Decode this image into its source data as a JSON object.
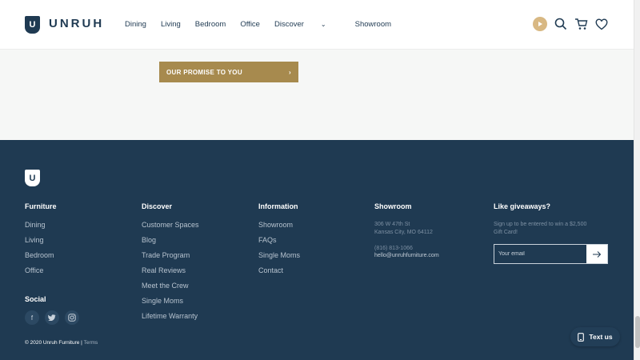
{
  "header": {
    "logo_letter": "U",
    "logo_text": "UNRUH",
    "nav": [
      "Dining",
      "Living",
      "Bedroom",
      "Office",
      "Discover",
      "Showroom"
    ],
    "discover_chevron": "⌄",
    "icons": [
      "play-icon",
      "search-icon",
      "cart-icon",
      "heart-icon"
    ]
  },
  "main": {
    "promise_label": "OUR PROMISE TO YOU",
    "promise_arrow": "›"
  },
  "footer": {
    "logo_letter": "U",
    "furniture": {
      "title": "Furniture",
      "links": [
        "Dining",
        "Living",
        "Bedroom",
        "Office"
      ]
    },
    "discover": {
      "title": "Discover",
      "links": [
        "Customer Spaces",
        "Blog",
        "Trade Program",
        "Real Reviews",
        "Meet the Crew",
        "Single Moms",
        "Lifetime Warranty"
      ]
    },
    "information": {
      "title": "Information",
      "links": [
        "Showroom",
        "FAQs",
        "Single Moms",
        "Contact"
      ]
    },
    "showroom": {
      "title": "Showroom",
      "address1": "306 W 47th St",
      "address2": "Kansas City, MO 64112",
      "phone": "(816) 813-1066",
      "email": "hello@unruhfurniture.com"
    },
    "giveaways": {
      "title": "Like giveaways?",
      "line1": "Sign up to be entered to win a $2,500",
      "line2": "Gift Card!",
      "email_placeholder": "Your email"
    },
    "social": {
      "title": "Social",
      "icons": [
        "facebook-icon",
        "twitter-icon",
        "instagram-icon"
      ]
    },
    "copyright": "© 2020 Unruh Furniture |",
    "terms": "Terms",
    "text_us": "Text us"
  },
  "colors": {
    "navy": "#1f3a52",
    "gold": "#a78a4e",
    "play_gold": "#d8b883"
  }
}
